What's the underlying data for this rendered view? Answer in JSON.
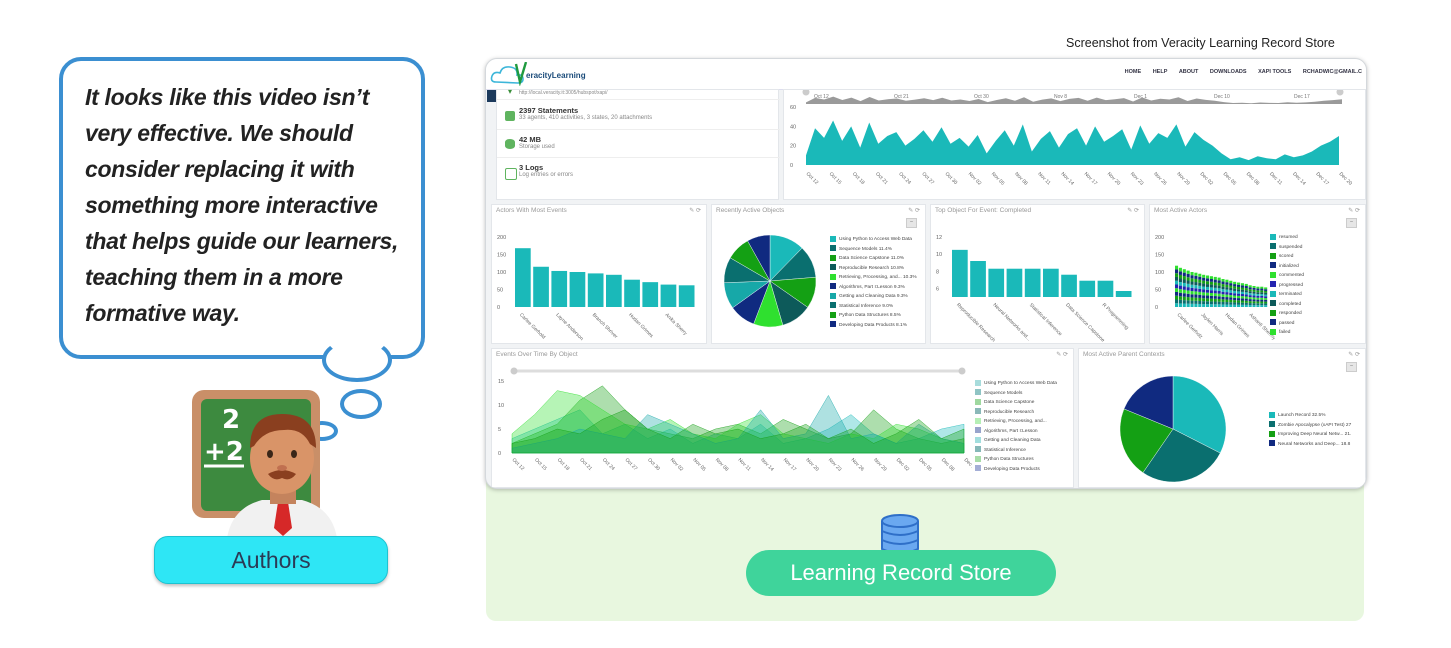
{
  "bubble": {
    "text": "It looks like this video isn’t very effective. We should consider replacing it with something more interactive that helps guide our learners, teaching them in a more formative way."
  },
  "authors": {
    "label": "Authors",
    "board_text_1": "2",
    "board_text_2": "+2"
  },
  "caption": "Screenshot from Veracity Learning Record Store",
  "lrs": {
    "label": "Learning Record Store"
  },
  "app": {
    "logo_text": "eracityLearning",
    "nav": [
      "HOME",
      "HELP",
      "ABOUT",
      "DOWNLOADS",
      "XAPI TOOLS",
      "RCHADWIC@GMAIL.C"
    ],
    "endpoint": "http://local.veracity.it:3005/hubspot/xapi/",
    "stats": [
      {
        "title": "2397 Statements",
        "sub": "33 agents, 410 activities, 3 states, 20 attachments",
        "icon": "puzzle-icon"
      },
      {
        "title": "42 MB",
        "sub": "Storage used",
        "icon": "database-icon"
      },
      {
        "title": "3 Logs",
        "sub": "Log entries or errors",
        "icon": "document-icon"
      }
    ],
    "colors": {
      "teal": "#1ab9b9",
      "dark_teal": "#0a6f6f",
      "green": "#14a014",
      "bright_green": "#2fe02f",
      "navy": "#102a80",
      "grey": "#9a9a9a"
    }
  },
  "timeline": {
    "nav_ticks": [
      "Oct 12",
      "Oct 21",
      "Oct 30",
      "Nov 8",
      "Dec 1",
      "Dec 10",
      "Dec 17"
    ],
    "yticks": [
      "60",
      "40",
      "20",
      "0"
    ],
    "dates": [
      "Oct 12",
      "Oct 15",
      "Oct 18",
      "Oct 21",
      "Oct 24",
      "Oct 27",
      "Oct 30",
      "Nov 02",
      "Nov 05",
      "Nov 08",
      "Nov 11",
      "Nov 14",
      "Nov 17",
      "Nov 20",
      "Nov 23",
      "Nov 26",
      "Nov 29",
      "Dec 02",
      "Dec 05",
      "Dec 08",
      "Dec 11",
      "Dec 14",
      "Dec 17",
      "Dec 20"
    ],
    "values": [
      10,
      38,
      28,
      46,
      25,
      40,
      18,
      44,
      22,
      30,
      34,
      20,
      27,
      36,
      24,
      39,
      22,
      28,
      19,
      31,
      12,
      25,
      36,
      20,
      42,
      14,
      27,
      35,
      18,
      32,
      38,
      20,
      40,
      24,
      30,
      37,
      16,
      41,
      22,
      33,
      28,
      42,
      19,
      34,
      26,
      20,
      12,
      6,
      8,
      5,
      9,
      7,
      6,
      11,
      8,
      10,
      14,
      20,
      24,
      30
    ]
  },
  "actors_events": {
    "title": "Actors With Most Events",
    "tools": "✎ ⟳",
    "yticks": [
      "200",
      "150",
      "100",
      "50",
      "0"
    ],
    "xlabels": [
      "Carlee Gerhold",
      "Layne Anderson",
      "Branch Shriver",
      "Hudan Grimes",
      "Anika Sherry"
    ],
    "chart_data": {
      "type": "bar",
      "values": [
        168,
        115,
        103,
        100,
        96,
        92,
        78,
        71,
        64,
        62
      ],
      "ylim": [
        0,
        200
      ]
    }
  },
  "recent_objects": {
    "title": "Recently Active Objects",
    "tools": "✎ ⟳",
    "legend": [
      {
        "label": "Using Python to Access Web Data",
        "color": "#1ab9b9"
      },
      {
        "label": "Sequence Models  11.4%",
        "color": "#0a6f6f"
      },
      {
        "label": "Data Science Capstone  11.0%",
        "color": "#14a014"
      },
      {
        "label": "Reproducible Research  10.8%",
        "color": "#0d5a5a"
      },
      {
        "label": "Retrieving, Processing, and...  10.3%",
        "color": "#2fe02f"
      },
      {
        "label": "Algorithms, Part I:Lesson  9.3%",
        "color": "#102a80"
      },
      {
        "label": "Getting and Cleaning Data  9.3%",
        "color": "#17a8a8"
      },
      {
        "label": "Statistical Inference  9.0%",
        "color": "#0a6f6f"
      },
      {
        "label": "Python Data Structures  8.5%",
        "color": "#14a014"
      },
      {
        "label": "Developing Data Products  8.1%",
        "color": "#102a80"
      }
    ],
    "chart_data": {
      "type": "pie",
      "values": [
        12.3,
        11.4,
        11.0,
        10.8,
        10.3,
        9.3,
        9.3,
        9.0,
        8.5,
        8.1
      ]
    }
  },
  "top_object": {
    "title": "Top Object For Event: Completed",
    "tools": "✎ ⟳",
    "yticks": [
      "12",
      "10",
      "8",
      "6"
    ],
    "xlabels": [
      "Reproducible Research",
      "Neural Networks and...",
      "Statistical Inference",
      "Data Science Capstone",
      "R Programming"
    ],
    "chart_data": {
      "type": "bar",
      "values": [
        10.5,
        9.2,
        8.3,
        8.3,
        8.3,
        8.3,
        7.6,
        6.9,
        6.9,
        5.7
      ],
      "ylim": [
        5,
        12
      ]
    }
  },
  "most_active_actors": {
    "title": "Most Active Actors",
    "tools": "✎ ⟳",
    "yticks": [
      "200",
      "150",
      "100",
      "50",
      "0"
    ],
    "xlabels": [
      "Carlee Gerholz",
      "Jaylen Harris",
      "Hudan Grimes",
      "Ashanti Shermy"
    ],
    "legend": [
      {
        "label": "resumed",
        "color": "#1ab9b9"
      },
      {
        "label": "suspended",
        "color": "#0a6f6f"
      },
      {
        "label": "scored",
        "color": "#14a014"
      },
      {
        "label": "initialized",
        "color": "#102a80"
      },
      {
        "label": "commented",
        "color": "#2fe02f"
      },
      {
        "label": "progressed",
        "color": "#2424b0"
      },
      {
        "label": "terminated",
        "color": "#1ab9b9"
      },
      {
        "label": "completed",
        "color": "#0d5a5a"
      },
      {
        "label": "responded",
        "color": "#14a014"
      },
      {
        "label": "passed",
        "color": "#102a80"
      },
      {
        "label": "failed",
        "color": "#2fe02f"
      }
    ],
    "chart_data": {
      "type": "bar",
      "stacked": true,
      "totals": [
        118,
        112,
        108,
        104,
        100,
        98,
        95,
        92,
        90,
        88,
        86,
        84,
        80,
        78,
        75,
        72,
        70,
        68,
        66,
        62,
        60,
        58,
        58,
        56
      ]
    }
  },
  "events_over_time": {
    "title": "Events Over Time By Object",
    "tools": "✎ ⟳",
    "yticks": [
      "15",
      "10",
      "5",
      "0"
    ],
    "xlabels": [
      "Oct 12",
      "Oct 15",
      "Oct 18",
      "Oct 21",
      "Oct 24",
      "Oct 27",
      "Oct 30",
      "Nov 02",
      "Nov 05",
      "Nov 08",
      "Nov 11",
      "Nov 14",
      "Nov 17",
      "Nov 20",
      "Nov 23",
      "Nov 26",
      "Nov 29",
      "Dec 02",
      "Dec 05",
      "Dec 08",
      "Dec 11"
    ],
    "legend": [
      {
        "label": "Using Python to Access Web Data",
        "color": "#a8dcdc"
      },
      {
        "label": "Sequence Models",
        "color": "#8fc4c4"
      },
      {
        "label": "Data Science Capstone",
        "color": "#9fd89f"
      },
      {
        "label": "Reproducible Research",
        "color": "#8ab8b8"
      },
      {
        "label": "Retrieving, Processing, and...",
        "color": "#b6efb6"
      },
      {
        "label": "Algorithms, Part I:Lesson",
        "color": "#98a4cc"
      },
      {
        "label": "Getting and Cleaning Data",
        "color": "#a2dede"
      },
      {
        "label": "Statistical Inference",
        "color": "#86b8b8"
      },
      {
        "label": "Python Data Structures",
        "color": "#a8dda8"
      },
      {
        "label": "Developing Data Products",
        "color": "#a4aed6"
      }
    ]
  },
  "parent_contexts": {
    "title": "Most Active Parent Contexts",
    "tools": "✎ ⟳",
    "legend": [
      {
        "label": "Launch Record  32.5%",
        "color": "#1ab9b9"
      },
      {
        "label": "Zombie Apocalypse (xAPI Test)  27",
        "color": "#0a6f6f"
      },
      {
        "label": "Improving Deep Neural Netw...  21.",
        "color": "#14a014"
      },
      {
        "label": "Neural Networks and Deep...  18.8",
        "color": "#102a80"
      }
    ],
    "chart_data": {
      "type": "pie",
      "values": [
        32.5,
        27.1,
        21.6,
        18.8
      ]
    }
  }
}
